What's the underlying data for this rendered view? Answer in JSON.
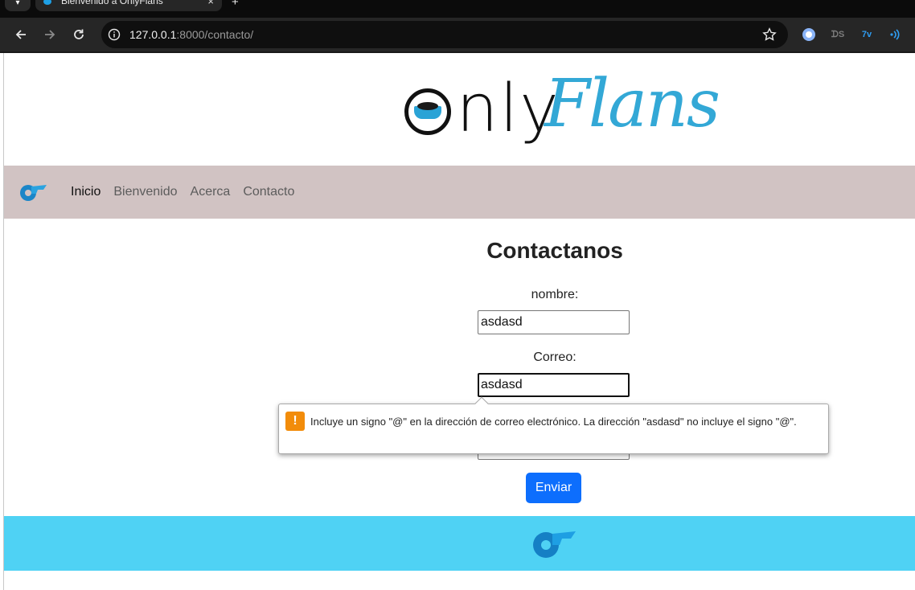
{
  "browser": {
    "tab_title": "Bienvenido a OnlyFlans",
    "tab_close": "×",
    "new_tab": "+",
    "url_host": "127.0.0.1",
    "url_rest": ":8000/contacto/",
    "extensions": [
      "lens-icon",
      "ds-extension-icon",
      "tv-extension-icon",
      "audio-extension-icon"
    ]
  },
  "logo": {
    "part1": "nly",
    "part2": "Flans"
  },
  "nav": {
    "items": [
      {
        "label": "Inicio",
        "active": true
      },
      {
        "label": "Bienvenido",
        "active": false
      },
      {
        "label": "Acerca",
        "active": false
      },
      {
        "label": "Contacto",
        "active": false
      }
    ]
  },
  "form": {
    "title": "Contactanos",
    "nombre_label": "nombre:",
    "nombre_value": "asdasd",
    "correo_label": "Correo:",
    "correo_value": "asdasd",
    "submit_label": "Enviar"
  },
  "validation": {
    "icon": "!",
    "message": "Incluye un signo \"@\" en la dirección de correo electrónico. La dirección \"asdasd\" no incluye el signo \"@\"."
  },
  "colors": {
    "navbar": "#d1c3c3",
    "footer": "#4fd2f4",
    "button": "#0d6efd",
    "brand_blue": "#33a8d6",
    "warning": "#f28c0a"
  }
}
